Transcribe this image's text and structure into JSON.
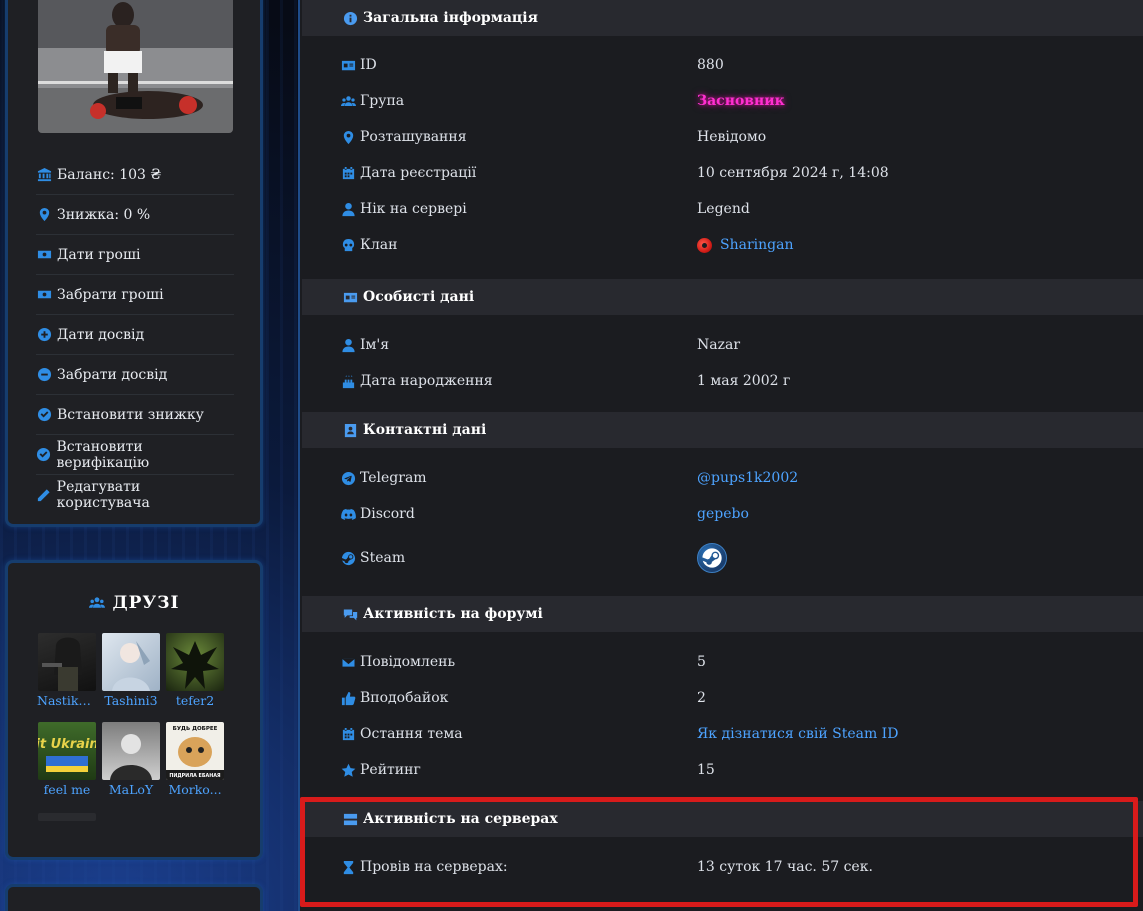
{
  "profile_menu": {
    "balance": "Баланс: 103 ₴",
    "discount": "Знижка: 0 %",
    "give_money": "Дати гроші",
    "take_money": "Забрати гроші",
    "give_exp": "Дати досвід",
    "take_exp": "Забрати досвід",
    "set_discount": "Встановити знижку",
    "set_verification": "Встановити верифікацію",
    "edit_user": "Редагувати користувача"
  },
  "friends": {
    "title": "ДРУЗІ",
    "items": [
      {
        "name": "Nastiksss"
      },
      {
        "name": "Tashini3"
      },
      {
        "name": "tefer2"
      },
      {
        "name": "feel me"
      },
      {
        "name": "MaLoY"
      },
      {
        "name": "Morko..."
      }
    ],
    "avatar_texts": {
      "feel_me": "Fit Ukraine",
      "morko_top": "БУДЬ ДОБРЕЕ",
      "morko_bottom": "ПИДРИЛА ЕБАНАЯ"
    }
  },
  "general": {
    "title": "Загальна інформація",
    "id_label": "ID",
    "id_value": "880",
    "group_label": "Група",
    "group_value": "Засновник",
    "location_label": "Розташування",
    "location_value": "Невідомо",
    "reg_label": "Дата реєстрації",
    "reg_value": "10 сентября 2024 г, 14:08",
    "nick_label": "Нік на сервері",
    "nick_value": "Legend",
    "clan_label": "Клан",
    "clan_value": "Sharingan"
  },
  "personal": {
    "title": "Особисті дані",
    "name_label": "Ім'я",
    "name_value": "Nazar",
    "birth_label": "Дата народження",
    "birth_value": "1 мая 2002 г"
  },
  "contacts": {
    "title": "Контактні дані",
    "telegram_label": "Telegram",
    "telegram_value": "@pups1k2002",
    "discord_label": "Discord",
    "discord_value": "gepebo",
    "steam_label": "Steam"
  },
  "forum": {
    "title": "Активність на форумі",
    "messages_label": "Повідомлень",
    "messages_value": "5",
    "likes_label": "Вподобайок",
    "likes_value": "2",
    "last_topic_label": "Остання тема",
    "last_topic_value": "Як дізнатися свій Steam ID",
    "rating_label": "Рейтинг",
    "rating_value": "15"
  },
  "servers": {
    "title": "Активність на серверах",
    "played_label": "Провів на серверах:",
    "played_value": "13 суток 17 час. 57 сек."
  },
  "colors": {
    "accent": "#2f8de4",
    "link": "#4da3ff",
    "group": "#ff2fd1",
    "highlight": "#d81b1b"
  }
}
